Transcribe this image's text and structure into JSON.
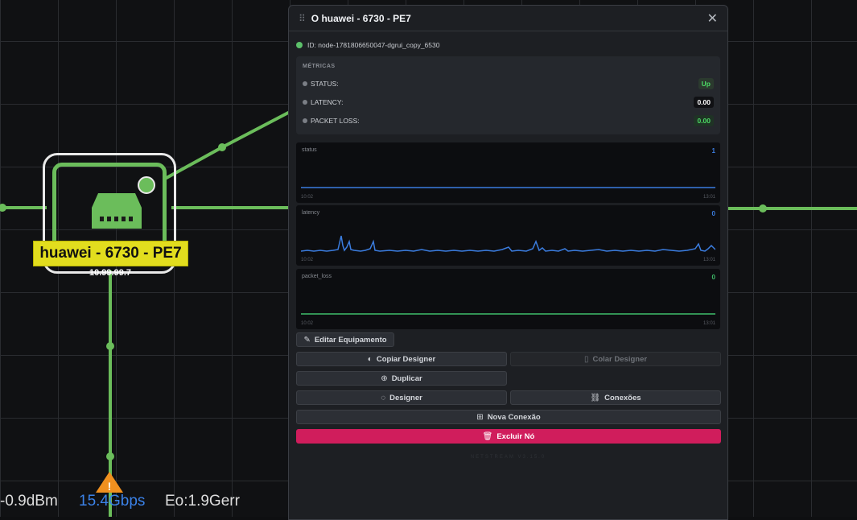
{
  "canvas": {
    "node_label": "huawei - 6730 - PE7",
    "node_ip": "10.99.99.7",
    "metric_power": "-0.9dBm",
    "metric_speed": "15.4Gbps",
    "metric_errors": "Eo:1.9Gerr",
    "warning_glyph": "!"
  },
  "panel": {
    "title": "huawei - 6730 - PE7",
    "id_text": "ID: node-1781806650047-dgrui_copy_6530",
    "metrics_heading": "MÉTRICAS",
    "metrics": [
      {
        "label": "STATUS:",
        "value": "Up",
        "color": "#4cd964"
      },
      {
        "label": "LATENCY:",
        "value": "0.00",
        "color": "#ffffff"
      },
      {
        "label": "PACKET LOSS:",
        "value": "0.00",
        "color": "#4cd964"
      }
    ],
    "charts": [
      {
        "name": "status",
        "current": "1",
        "start": "10:02",
        "end": "13:01",
        "color": "#3b7de0"
      },
      {
        "name": "latency",
        "current": "0",
        "start": "10:02",
        "end": "13:01",
        "color": "#3b7de0"
      },
      {
        "name": "packet_loss",
        "current": "0",
        "start": "10:02",
        "end": "13:01",
        "color": "#3fbf6a"
      }
    ],
    "buttons": {
      "edit": "Editar Equipamento",
      "copy_designer": "Copiar Designer",
      "paste_designer": "Colar Designer",
      "duplicate": "Duplicar",
      "designer": "Designer",
      "connections": "Conexões",
      "new_connection": "Nova Conexão",
      "delete": "Excluir Nó"
    },
    "footer": "NETSTREAM V3.15.0"
  }
}
